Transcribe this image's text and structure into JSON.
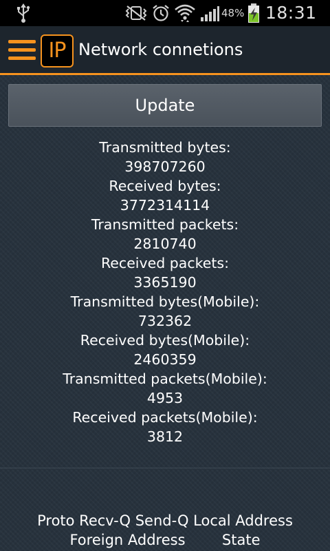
{
  "status_bar": {
    "battery_percent": "48%",
    "time": "18:31",
    "icons": [
      "usb-icon",
      "vibrate-mute-icon",
      "alarm-icon",
      "wifi-icon",
      "signal-icon",
      "battery-charging-icon"
    ]
  },
  "action_bar": {
    "logo_text": "IP",
    "title": "Network connetions"
  },
  "update_label": "Update",
  "stats": [
    {
      "label": "Transmitted bytes:",
      "value": "398707260"
    },
    {
      "label": "Received bytes:",
      "value": "3772314114"
    },
    {
      "label": "Transmitted packets:",
      "value": "2810740"
    },
    {
      "label": "Received packets:",
      "value": "3365190"
    },
    {
      "label": "Transmitted bytes(Mobile):",
      "value": "732362"
    },
    {
      "label": "Received bytes(Mobile):",
      "value": "2460359"
    },
    {
      "label": "Transmitted packets(Mobile):",
      "value": "4953"
    },
    {
      "label": "Received packets(Mobile):",
      "value": "3812"
    }
  ],
  "netstat_header": {
    "line1": "Proto Recv-Q Send-Q Local Address",
    "line2": "Foreign Address        State"
  },
  "colors": {
    "accent": "#f7931e",
    "background": "#27323d",
    "action_bar": "#1d252d",
    "button": "#525a63"
  }
}
